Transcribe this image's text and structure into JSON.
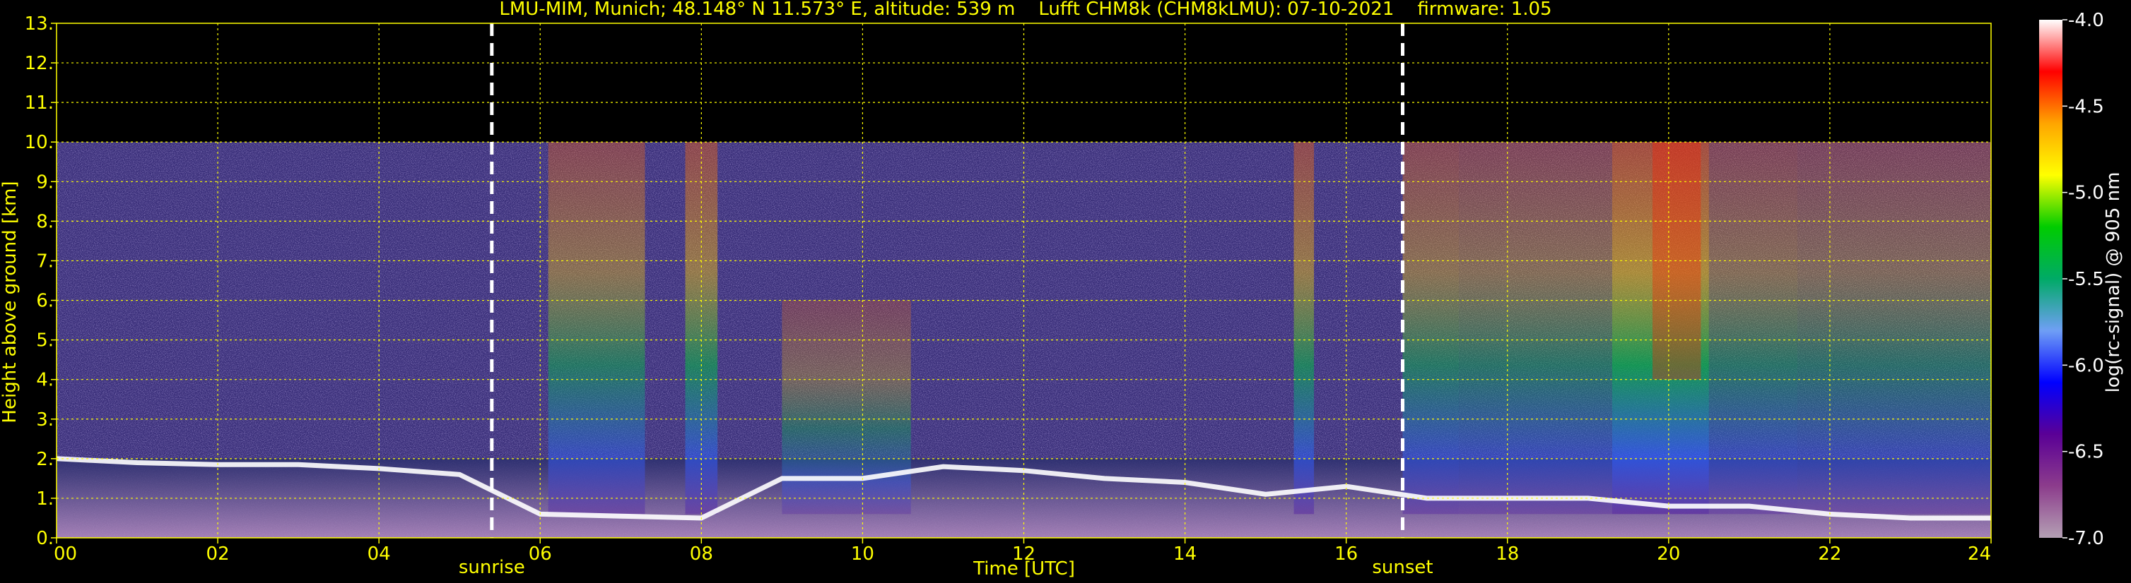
{
  "chart_data": {
    "type": "heatmap",
    "title": "LMU-MIM, Munich; 48.148° N 11.573° E, altitude: 539 m    Lufft CHM8k (CHM8kLMU): 07-10-2021    firmware: 1.05",
    "xlabel": "Time [UTC]",
    "ylabel": "Height above ground [km]",
    "xlim": [
      0,
      24
    ],
    "ylim": [
      0,
      13
    ],
    "xticks": [
      0,
      2,
      4,
      6,
      8,
      10,
      12,
      14,
      16,
      18,
      20,
      22,
      24
    ],
    "xticklabels": [
      "00",
      "02",
      "04",
      "06",
      "08",
      "10",
      "12",
      "14",
      "16",
      "18",
      "20",
      "22",
      "24"
    ],
    "yticks": [
      0,
      1,
      2,
      3,
      4,
      5,
      6,
      7,
      8,
      9,
      10,
      11,
      12,
      13
    ],
    "yticklabels": [
      "0.",
      "1.",
      "2.",
      "3.",
      "4.",
      "5.",
      "6.",
      "7.",
      "8.",
      "9.",
      "10.",
      "11.",
      "12.",
      "13."
    ],
    "data_top_km": 10,
    "grid": true,
    "grid_color": "#ffff00",
    "text_color": "#ffff00",
    "annotations": [
      {
        "label": "sunrise",
        "x": 5.4
      },
      {
        "label": "sunset",
        "x": 16.7
      }
    ],
    "colorbar": {
      "label": "log(rc-signal) @ 905 nm",
      "min": -7.0,
      "max": -4.0,
      "ticks": [
        -4.0,
        -4.5,
        -5.0,
        -5.5,
        -6.0,
        -6.5,
        -7.0
      ],
      "ticklabels": [
        "-4.0",
        "-4.5",
        "-5.0",
        "-5.5",
        "-6.0",
        "-6.5",
        "-7.0"
      ],
      "colors": [
        "#ffffff",
        "#ff0000",
        "#ffa500",
        "#ffff00",
        "#00cc00",
        "#00aa66",
        "#6f9ff5",
        "#0000ff",
        "#5a0096",
        "#8c3c8c",
        "#b4a0b4"
      ]
    },
    "features": {
      "boundary_layer_top_km": [
        [
          0,
          2.0
        ],
        [
          1,
          1.9
        ],
        [
          2,
          1.85
        ],
        [
          3,
          1.85
        ],
        [
          4,
          1.75
        ],
        [
          5,
          1.6
        ],
        [
          6,
          0.6
        ],
        [
          7,
          0.55
        ],
        [
          8,
          0.5
        ],
        [
          9,
          1.5
        ],
        [
          10,
          1.5
        ],
        [
          11,
          1.8
        ],
        [
          12,
          1.7
        ],
        [
          13,
          1.5
        ],
        [
          14,
          1.4
        ],
        [
          15,
          1.1
        ],
        [
          16,
          1.3
        ],
        [
          17,
          1.0
        ],
        [
          18,
          1.0
        ],
        [
          19,
          1.0
        ],
        [
          20,
          0.8
        ],
        [
          21,
          0.8
        ],
        [
          22,
          0.6
        ],
        [
          23,
          0.5
        ],
        [
          24,
          0.5
        ]
      ]
    }
  }
}
